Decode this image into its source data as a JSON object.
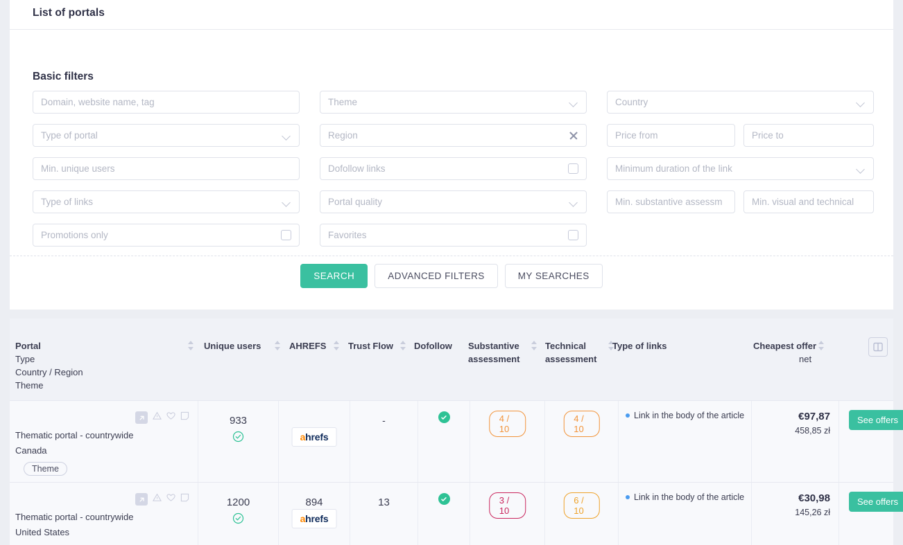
{
  "panel": {
    "title": "List of portals",
    "filters_section_title": "Basic filters"
  },
  "filters": {
    "domain": {
      "placeholder": "Domain, website name, tag"
    },
    "type_of_portal": {
      "placeholder": "Type of portal"
    },
    "min_unique_users": {
      "placeholder": "Min. unique users"
    },
    "type_of_links": {
      "placeholder": "Type of links"
    },
    "promotions_only": {
      "placeholder": "Promotions only"
    },
    "theme": {
      "placeholder": "Theme"
    },
    "region": {
      "placeholder": "Region"
    },
    "dofollow_links": {
      "placeholder": "Dofollow links"
    },
    "portal_quality": {
      "placeholder": "Portal quality"
    },
    "favorites": {
      "placeholder": "Favorites"
    },
    "country": {
      "placeholder": "Country"
    },
    "price_from": {
      "placeholder": "Price from"
    },
    "price_to": {
      "placeholder": "Price to"
    },
    "min_duration": {
      "placeholder": "Minimum duration of the link"
    },
    "min_substantive": {
      "placeholder": "Min. substantive assessm"
    },
    "min_visual": {
      "placeholder": "Min. visual and technical"
    }
  },
  "actions": {
    "search": "SEARCH",
    "advanced_filters": "ADVANCED FILTERS",
    "my_searches": "MY SEARCHES"
  },
  "table": {
    "headers": {
      "portal": "Portal",
      "portal_sub1": "Type",
      "portal_sub2": "Country / Region",
      "portal_sub3": "Theme",
      "unique_users": "Unique users",
      "ahrefs": "AHREFS",
      "trust_flow": "Trust Flow",
      "dofollow": "Dofollow",
      "substantive_1": "Substantive",
      "substantive_2": "assessment",
      "technical_1": "Technical",
      "technical_2": "assessment",
      "type_of_links": "Type of links",
      "cheapest_1": "Cheapest offer",
      "cheapest_2": "net"
    },
    "rows": [
      {
        "type": "Thematic portal - countrywide",
        "country": "Canada",
        "theme_tag": "Theme",
        "unique_users": "933",
        "ahrefs": "",
        "ahrefs_badge": "ahrefs",
        "trust_flow": "-",
        "dofollow": true,
        "substantive": "4 / 10",
        "substantive_color": "#f29339",
        "technical": "4 / 10",
        "technical_color": "#f29339",
        "type_of_links": "Link in the body of the article",
        "price_eur": "€97,87",
        "price_pln": "458,85 zł",
        "cta": "See offers"
      },
      {
        "type": "Thematic portal - countrywide",
        "country": "United States",
        "theme_tag": "",
        "unique_users": "1200",
        "ahrefs": "894",
        "ahrefs_badge": "ahrefs",
        "trust_flow": "13",
        "dofollow": true,
        "substantive": "3 / 10",
        "substantive_color": "#c9245c",
        "technical": "6 / 10",
        "technical_color": "#eea229",
        "type_of_links": "Link in the body of the article",
        "price_eur": "€30,98",
        "price_pln": "145,26 zł",
        "cta": "See offers"
      }
    ]
  },
  "colors": {
    "accent_green": "#3ac0a0",
    "orange": "#f29339",
    "crimson": "#c9245c",
    "amber": "#eea229",
    "blue_dot": "#4a9bf0"
  },
  "icons": {
    "external_link": "external-link-icon",
    "warning": "warning-triangle-icon",
    "favorite": "heart-icon",
    "note": "note-icon",
    "columns": "columns-layout-icon"
  }
}
